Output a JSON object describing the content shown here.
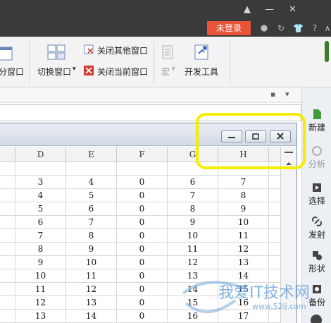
{
  "window": {
    "minimize": "▲",
    "restore": "—",
    "close": "✕",
    "login": "未登录"
  },
  "ribbon": {
    "window_partial": "分窗口",
    "switch_window": "切换窗口",
    "switch_arrow": "▾",
    "close_others": "关闭其他窗口",
    "close_current": "关闭当前窗口",
    "macro": "宏",
    "macro_arrow": "▾",
    "dev_tools": "开发工具"
  },
  "sidepanel": {
    "items": [
      {
        "label": "新建",
        "icon": "new-doc-icon"
      },
      {
        "label": "分析",
        "icon": "analysis-icon"
      },
      {
        "label": "选择",
        "icon": "select-icon"
      },
      {
        "label": "发射",
        "icon": "launch-icon"
      },
      {
        "label": "形状",
        "icon": "shape-icon"
      },
      {
        "label": "备份",
        "icon": "backup-icon"
      }
    ]
  },
  "sheet": {
    "columns": [
      "D",
      "E",
      "F",
      "G",
      "H"
    ],
    "rows": [
      [
        "3",
        "4",
        "0",
        "6",
        "7"
      ],
      [
        "4",
        "5",
        "0",
        "7",
        "8"
      ],
      [
        "5",
        "6",
        "0",
        "8",
        "9"
      ],
      [
        "6",
        "7",
        "0",
        "9",
        "10"
      ],
      [
        "7",
        "8",
        "0",
        "10",
        "11"
      ],
      [
        "8",
        "9",
        "0",
        "11",
        "12"
      ],
      [
        "9",
        "10",
        "0",
        "12",
        "13"
      ],
      [
        "10",
        "11",
        "0",
        "13",
        "14"
      ],
      [
        "11",
        "12",
        "0",
        "14",
        "15"
      ],
      [
        "12",
        "13",
        "0",
        "15",
        "16"
      ],
      [
        "13",
        "14",
        "0",
        "16",
        "17"
      ]
    ]
  },
  "watermark": {
    "main": "我爱IT技术网",
    "sub": "www.52ij.com"
  },
  "colors": {
    "login_bg": "#e8543a",
    "highlight": "#f5ec00",
    "titlebar": "#3a3a3a"
  }
}
